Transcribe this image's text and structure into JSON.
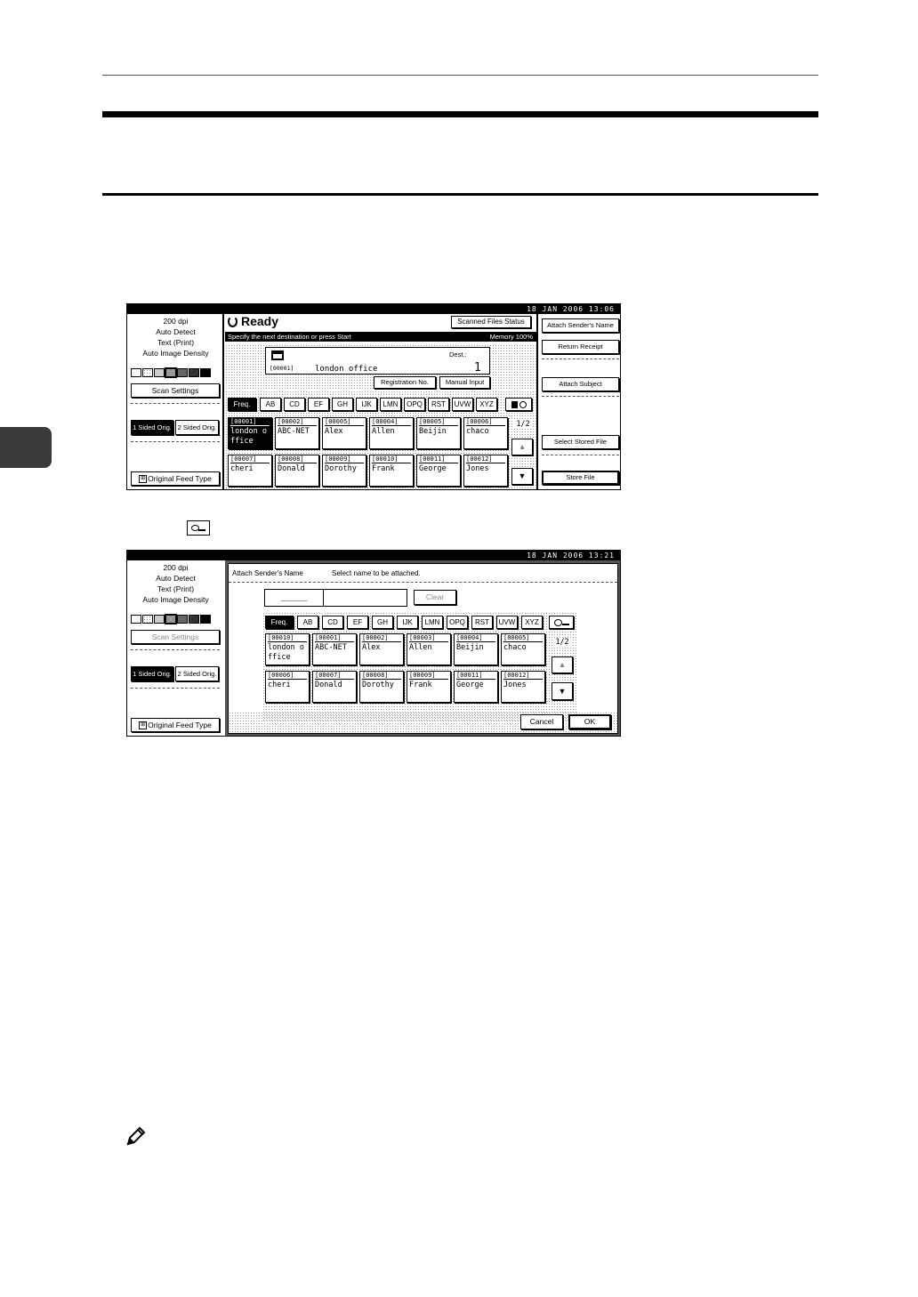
{
  "inline_icon": "search-icon",
  "note_icon": "pencil-icon",
  "screen1": {
    "datetime": "18  JAN   2006 13:06",
    "left": {
      "lines": [
        "200 dpi",
        "Auto Detect",
        "Text (Print)",
        "Auto Image Density"
      ],
      "scan_settings": "Scan Settings",
      "one_sided": "1 Sided Orig.",
      "two_sided": "2 Sided Orig.",
      "feed_type": "Original Feed Type"
    },
    "status": "Ready",
    "instruction": "Specify the next destination or press Start",
    "scanned_files_status": "Scanned Files Status",
    "memory": "Memory 100%",
    "dest_label": "Dest.:",
    "dest_count": "1",
    "dest_id": "[00001]",
    "dest_name": "london office",
    "registration_no": "Registration No.",
    "manual_input": "Manual Input",
    "tabs": [
      "Freq.",
      "AB",
      "CD",
      "EF",
      "GH",
      "IJK",
      "LMN",
      "OPQ",
      "RST",
      "UVW",
      "XYZ"
    ],
    "page": "1/2",
    "cells": [
      {
        "id": "[00001]",
        "name": "london office"
      },
      {
        "id": "[00002]",
        "name": "ABC-NET"
      },
      {
        "id": "[00005]",
        "name": "Alex"
      },
      {
        "id": "[00004]",
        "name": "Allen"
      },
      {
        "id": "[00005]",
        "name": "Beijin"
      },
      {
        "id": "[00006]",
        "name": "chaco"
      },
      {
        "id": "[00007]",
        "name": "cheri"
      },
      {
        "id": "[00008]",
        "name": "Donald"
      },
      {
        "id": "[00009]",
        "name": "Dorothy"
      },
      {
        "id": "[00010]",
        "name": "Frank"
      },
      {
        "id": "[00011]",
        "name": "George"
      },
      {
        "id": "[00012]",
        "name": "Jones"
      }
    ],
    "right": {
      "attach_sender": "Attach Sender's Name",
      "return_receipt": "Return Receipt",
      "attach_subject": "Attach Subject",
      "select_stored": "Select Stored File",
      "store_file": "Store File"
    }
  },
  "screen2": {
    "datetime": "18  JAN   2006 13:21",
    "title": "Attach Sender's Name",
    "instruction": "Select name to be attached.",
    "input_value": "_____",
    "clear_button": "Clear",
    "tabs": [
      "Freq.",
      "AB",
      "CD",
      "EF",
      "GH",
      "IJK",
      "LMN",
      "OPQ",
      "RST",
      "UVW",
      "XYZ"
    ],
    "page": "1/2",
    "cells": [
      {
        "id": "[00010]",
        "name": "london office"
      },
      {
        "id": "[00001]",
        "name": "ABC-NET"
      },
      {
        "id": "[00002]",
        "name": "Alex"
      },
      {
        "id": "[00003]",
        "name": "Allen"
      },
      {
        "id": "[00004]",
        "name": "Beijin"
      },
      {
        "id": "[00005]",
        "name": "chaco"
      },
      {
        "id": "[00006]",
        "name": "cheri"
      },
      {
        "id": "[00007]",
        "name": "Donald"
      },
      {
        "id": "[00008]",
        "name": "Dorothy"
      },
      {
        "id": "[00009]",
        "name": "Frank"
      },
      {
        "id": "[00011]",
        "name": "George"
      },
      {
        "id": "[00012]",
        "name": "Jones"
      }
    ],
    "cancel": "Cancel",
    "ok": "OK"
  }
}
